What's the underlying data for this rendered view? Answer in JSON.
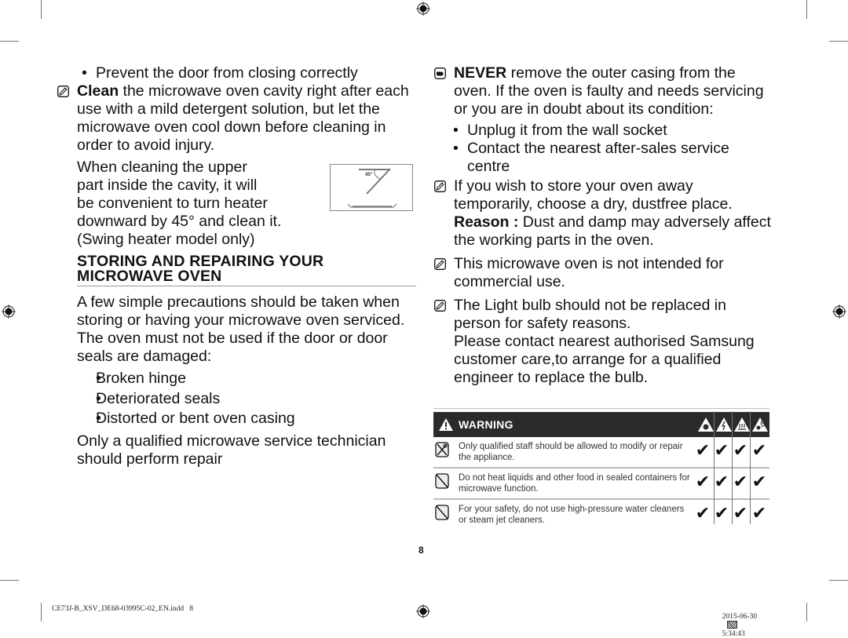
{
  "page_number": "8",
  "left_column": {
    "bullet_prevent": "Prevent the door from closing correctly",
    "clean_bold": "Clean",
    "clean_text": " the microwave oven cavity right after each use with a mild detergent solution, but let the microwave oven cool down before cleaning in order to avoid injury.",
    "upper_lines": [
      "When cleaning the upper",
      "part inside the cavity, it will",
      "be convenient to turn heater",
      "downward by 45° and clean it.",
      "(Swing heater model only)"
    ],
    "figure_label": "45°",
    "heading_line1": "STORING AND REPAIRING YOUR",
    "heading_line2": "MICROWAVE OVEN",
    "intro": "A few simple precautions should be taken when storing or having your microwave oven serviced.",
    "door_text": "The oven must not be used if the door or door seals are damaged:",
    "damage_bullets": [
      "Broken hinge",
      "Deteriorated seals",
      "Distorted or bent oven casing"
    ],
    "qualified": "Only a qualified microwave service technician should perform repair"
  },
  "right_column": {
    "never_bold": "NEVER",
    "never_text": " remove the outer casing from the oven. If the oven is faulty and needs servicing or you are in doubt about its condition:",
    "never_bullets": [
      "Unplug it from the wall socket",
      "Contact the nearest after-sales service centre"
    ],
    "store_text": "If you wish to store your oven away temporarily, choose a dry, dustfree place.",
    "reason_bold": "Reason :",
    "reason_text": " Dust and damp may adversely affect the working parts in the oven.",
    "commercial": "This microwave oven is not intended for commercial use.",
    "bulb1": "The Light bulb should not be replaced in person for safety reasons.",
    "bulb2": "Please contact nearest authorised Samsung customer care,to arrange for a qualified engineer to replace the bulb."
  },
  "warning": {
    "title": "WARNING",
    "hazard_icons": [
      "fire-hazard-icon",
      "electric-shock-icon",
      "hot-surface-icon",
      "explosion-icon"
    ],
    "rows": [
      {
        "icon": "no-disassemble-icon",
        "text": "Only qualified staff should be allowed to modify or repair the appliance.",
        "checks": [
          true,
          true,
          true,
          true
        ]
      },
      {
        "icon": "prohibited-icon",
        "text": "Do not heat liquids and other food in sealed containers for microwave function.",
        "checks": [
          true,
          true,
          true,
          true
        ]
      },
      {
        "icon": "prohibited-icon",
        "text": "For your safety, do not use high-pressure water cleaners or steam jet cleaners.",
        "checks": [
          true,
          true,
          true,
          true
        ]
      }
    ],
    "check_glyph": "✔"
  },
  "footer": {
    "filename": "CE73J-B_XSV_DE68-03995C-02_EN.indd   8",
    "date": "2015-06-30",
    "time": "5:34:43"
  }
}
